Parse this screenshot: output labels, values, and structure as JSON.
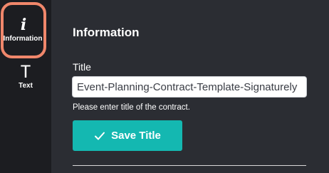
{
  "sidebar": {
    "items": [
      {
        "glyph": "i",
        "label": "Information",
        "icon": "info-icon",
        "active": true
      },
      {
        "glyph": "T",
        "label": "Text",
        "icon": "text-icon",
        "active": false
      }
    ]
  },
  "panel": {
    "title": "Information",
    "field_label": "Title",
    "title_value": "Event-Planning-Contract-Template-Signaturely",
    "helper_text": "Please enter title of the contract.",
    "save_label": "Save Title"
  },
  "colors": {
    "sidebar_bg": "#1c1d21",
    "panel_bg": "#2b2d33",
    "active_highlight": "#f0876b",
    "accent_button": "#14b8b1"
  }
}
